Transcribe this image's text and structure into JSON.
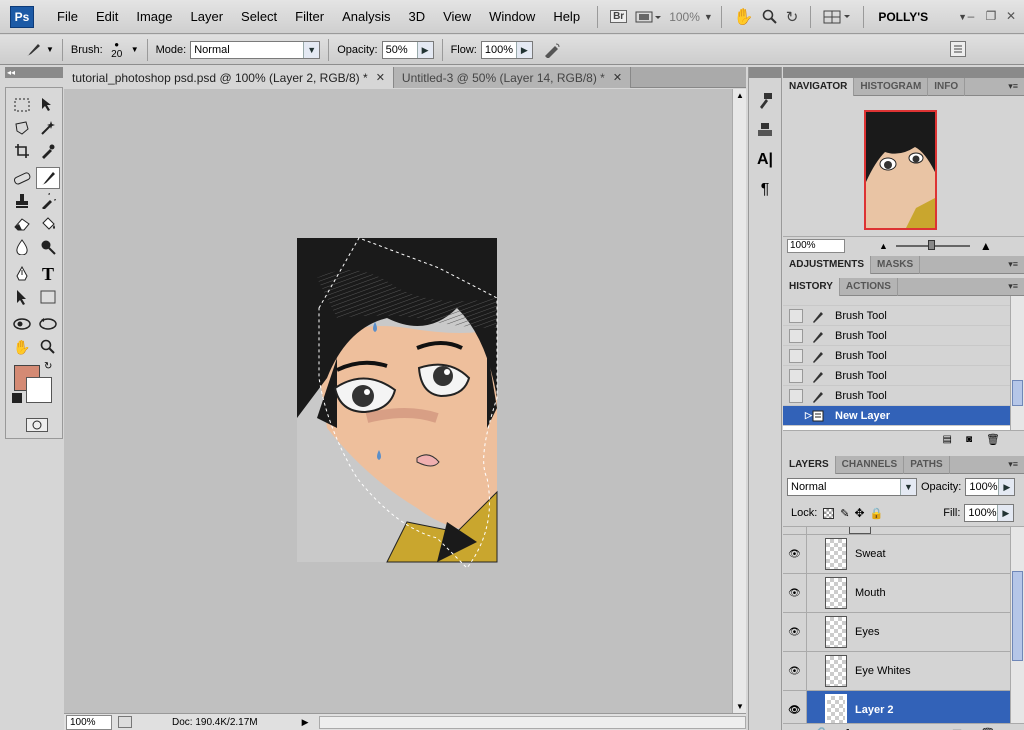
{
  "menubar": {
    "logo": "Ps",
    "items": [
      "File",
      "Edit",
      "Image",
      "Layer",
      "Select",
      "Filter",
      "Analysis",
      "3D",
      "View",
      "Window",
      "Help"
    ],
    "bridge_label": "Br",
    "zoom": "100%",
    "workspace": "POLLY'S"
  },
  "options": {
    "brush_label": "Brush:",
    "brush_size": "20",
    "mode_label": "Mode:",
    "mode_value": "Normal",
    "opacity_label": "Opacity:",
    "opacity_value": "50%",
    "flow_label": "Flow:",
    "flow_value": "100%"
  },
  "tabs": [
    {
      "label": "tutorial_photoshop psd.psd @ 100% (Layer 2, RGB/8) *",
      "active": true
    },
    {
      "label": "Untitled-3 @ 50% (Layer 14, RGB/8) *",
      "active": false
    }
  ],
  "colors": {
    "foreground": "#d48a74",
    "background": "#ffffff",
    "selection": "#3262b8"
  },
  "status": {
    "zoom": "100%",
    "doc": "Doc: 190.4K/2.17M"
  },
  "navigator": {
    "tabs": [
      "NAVIGATOR",
      "HISTOGRAM",
      "INFO"
    ],
    "zoom": "100%"
  },
  "adjustments": {
    "tabs": [
      "ADJUSTMENTS",
      "MASKS"
    ]
  },
  "history": {
    "tabs": [
      "HISTORY",
      "ACTIONS"
    ],
    "items": [
      {
        "label": "Brush Tool",
        "icon": "brush-icon"
      },
      {
        "label": "Brush Tool",
        "icon": "brush-icon"
      },
      {
        "label": "Brush Tool",
        "icon": "brush-icon"
      },
      {
        "label": "Brush Tool",
        "icon": "brush-icon"
      },
      {
        "label": "Brush Tool",
        "icon": "brush-icon"
      },
      {
        "label": "New Layer",
        "icon": "new-layer-icon",
        "selected": true
      }
    ]
  },
  "layers": {
    "tabs": [
      "LAYERS",
      "CHANNELS",
      "PATHS"
    ],
    "blend_mode": "Normal",
    "opacity_label": "Opacity:",
    "opacity": "100%",
    "lock_label": "Lock:",
    "fill_label": "Fill:",
    "fill": "100%",
    "items": [
      {
        "name": "Sweat"
      },
      {
        "name": "Mouth"
      },
      {
        "name": "Eyes"
      },
      {
        "name": "Eye Whites"
      },
      {
        "name": "Layer 2",
        "selected": true
      }
    ]
  }
}
